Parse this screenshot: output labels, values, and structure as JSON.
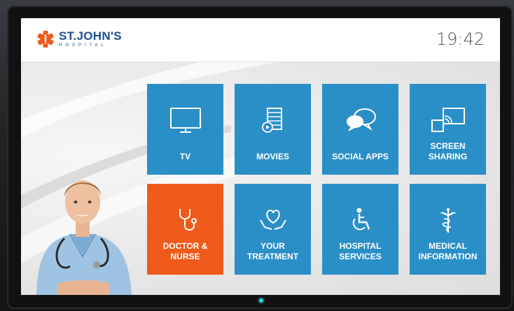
{
  "header": {
    "logo_name": "ST.JOHN'S",
    "logo_sub": "HOSPITAL",
    "clock": "19:42"
  },
  "colors": {
    "tile_blue": "#2b8fc7",
    "tile_orange": "#f05a1a",
    "brand_blue": "#1f4f8f",
    "logo_orange": "#f05a1a"
  },
  "tiles": [
    {
      "label": "TV",
      "icon": "tv-icon"
    },
    {
      "label": "MOVIES",
      "icon": "film-icon"
    },
    {
      "label": "SOCIAL APPS",
      "icon": "chat-bubbles-icon"
    },
    {
      "label": "SCREEN\nSHARING",
      "icon": "cast-icon"
    },
    {
      "label": "DOCTOR &\nNURSE",
      "icon": "stethoscope-icon"
    },
    {
      "label": "YOUR\nTREATMENT",
      "icon": "heart-hands-icon"
    },
    {
      "label": "HOSPITAL\nSERVICES",
      "icon": "wheelchair-icon"
    },
    {
      "label": "MEDICAL\nINFORMATION",
      "icon": "caduceus-icon"
    }
  ]
}
